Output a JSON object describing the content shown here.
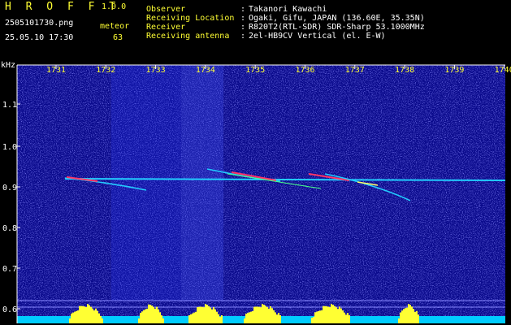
{
  "header": {
    "brand": "H R O F F T",
    "version": "1.0.0",
    "filename": "2505101730.png",
    "event_type": "meteor",
    "datetime": "25.05.10 17:30",
    "count": "63",
    "info_rows": [
      {
        "label": "Observer",
        "value": "Takanori Kawachi"
      },
      {
        "label": "Receiving Location",
        "value": "Ogaki, Gifu, JAPAN (136.60E, 35.35N)"
      },
      {
        "label": "Receiver",
        "value": "R820T2(RTL-SDR) SDR-Sharp 53.1000MHz"
      },
      {
        "label": "Receiving antenna",
        "value": "2el-HB9CV Vertical (el. E-W)"
      }
    ],
    "separator": ":"
  },
  "plot": {
    "y_unit": "kHz",
    "x_ticks": [
      "1731",
      "1732",
      "1733",
      "1734",
      "1735",
      "1736",
      "1737",
      "1738",
      "1739",
      "1740"
    ],
    "y_ticks": [
      "1.1",
      "1.0",
      "0.9",
      "0.8",
      "0.7",
      "0.6"
    ],
    "colors": {
      "background": "#000000",
      "field": "#0a0a8c",
      "noise": "#3a3aff",
      "tick_label": "#ffff33",
      "axis_label": "#ffffff",
      "echo_main": "#22ccff",
      "echo_hot": "#ff3366",
      "bar_fill": "#ffff33",
      "bar_base": "#00ccff"
    }
  }
}
